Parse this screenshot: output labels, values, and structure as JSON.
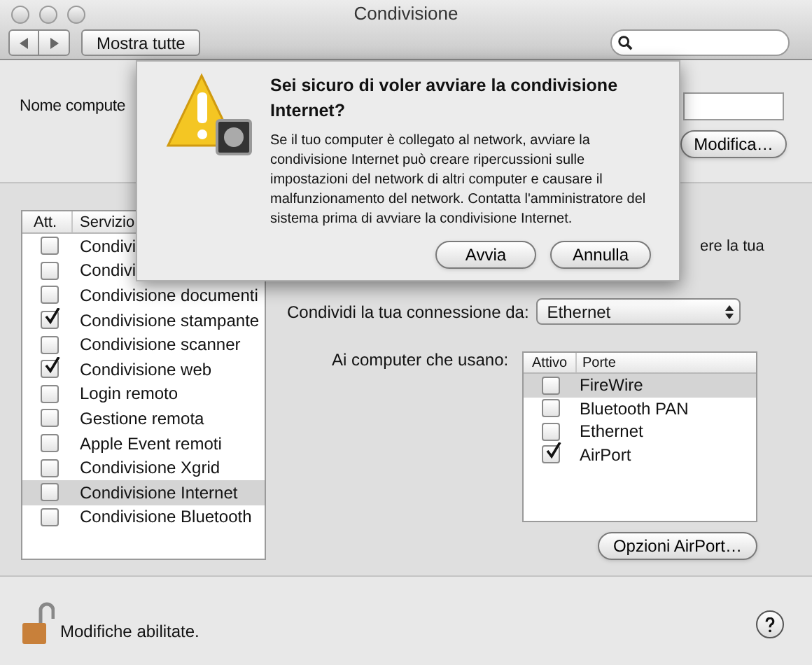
{
  "window": {
    "title": "Condivisione"
  },
  "toolbar": {
    "show_all": "Mostra tutte"
  },
  "computer_name": {
    "label": "Nome compute",
    "edit_button": "Modifica…"
  },
  "services": {
    "columns": [
      "Att.",
      "Servizio"
    ],
    "rows": [
      {
        "name": "Condivi",
        "checked": false,
        "selected": false
      },
      {
        "name": "Condivi",
        "checked": false,
        "selected": false
      },
      {
        "name": "Condivisione documenti",
        "checked": false,
        "selected": false
      },
      {
        "name": "Condivisione stampante",
        "checked": true,
        "selected": false
      },
      {
        "name": "Condivisione scanner",
        "checked": false,
        "selected": false
      },
      {
        "name": "Condivisione web",
        "checked": true,
        "selected": false
      },
      {
        "name": "Login remoto",
        "checked": false,
        "selected": false
      },
      {
        "name": "Gestione remota",
        "checked": false,
        "selected": false
      },
      {
        "name": "Apple Event remoti",
        "checked": false,
        "selected": false
      },
      {
        "name": "Condivisione Xgrid",
        "checked": false,
        "selected": false
      },
      {
        "name": "Condivisione Internet",
        "checked": false,
        "selected": true
      },
      {
        "name": "Condivisione Bluetooth",
        "checked": false,
        "selected": false
      }
    ]
  },
  "description_fragment": "ere la tua",
  "share_from": {
    "label": "Condividi la tua connessione da:",
    "value": "Ethernet"
  },
  "ports": {
    "label": "Ai computer che usano:",
    "columns": [
      "Attivo",
      "Porte"
    ],
    "rows": [
      {
        "name": "FireWire",
        "checked": false,
        "selected": true
      },
      {
        "name": "Bluetooth PAN",
        "checked": false,
        "selected": false
      },
      {
        "name": "Ethernet",
        "checked": false,
        "selected": false
      },
      {
        "name": "AirPort",
        "checked": true,
        "selected": false
      }
    ]
  },
  "airport_button": "Opzioni AirPort…",
  "lock": {
    "text": "Modifiche abilitate.",
    "locked": false
  },
  "sheet": {
    "title": "Sei sicuro di voler avviare la condivisione Internet?",
    "message": "Se il tuo computer è collegato al network, avviare la condivisione Internet può creare ripercussioni sulle impostazioni del network di altri computer e causare il malfunzionamento del network. Contatta l'amministratore del sistema prima di avviare la condivisione Internet.",
    "buttons": [
      "Avvia",
      "Annulla"
    ]
  }
}
